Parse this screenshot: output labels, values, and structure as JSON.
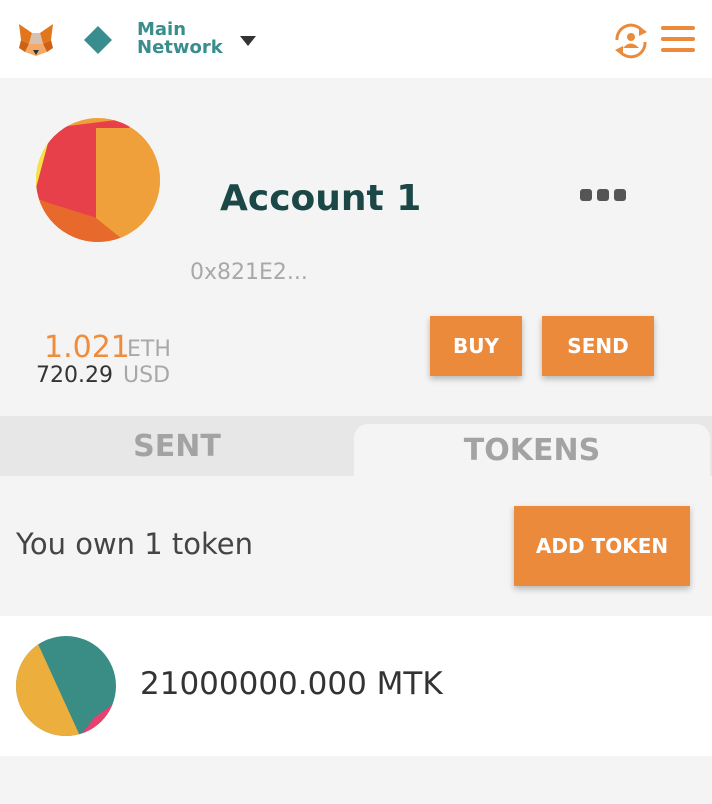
{
  "header": {
    "network_line1": "Main",
    "network_line2": "Network",
    "colors": {
      "accent": "#ec8a3b",
      "network": "#3a8d8d"
    },
    "icons": [
      "metamask-fox-icon",
      "network-diamond-icon",
      "caret-down-icon",
      "account-switch-icon",
      "hamburger-menu-icon"
    ]
  },
  "account": {
    "name": "Account 1",
    "address": "0x821E2...",
    "balance_eth": "1.021",
    "eth_unit": "ETH",
    "balance_usd": "720.29",
    "usd_unit": "USD",
    "more_icon": "more-dots-icon"
  },
  "actions": {
    "buy_label": "BUY",
    "send_label": "SEND"
  },
  "tabs": [
    {
      "label": "SENT",
      "active": false
    },
    {
      "label": "TOKENS",
      "active": true
    }
  ],
  "tokens_panel": {
    "summary": "You own 1 token",
    "add_token_label": "ADD TOKEN",
    "items": [
      {
        "amount": "21000000.000 MTK"
      }
    ]
  }
}
